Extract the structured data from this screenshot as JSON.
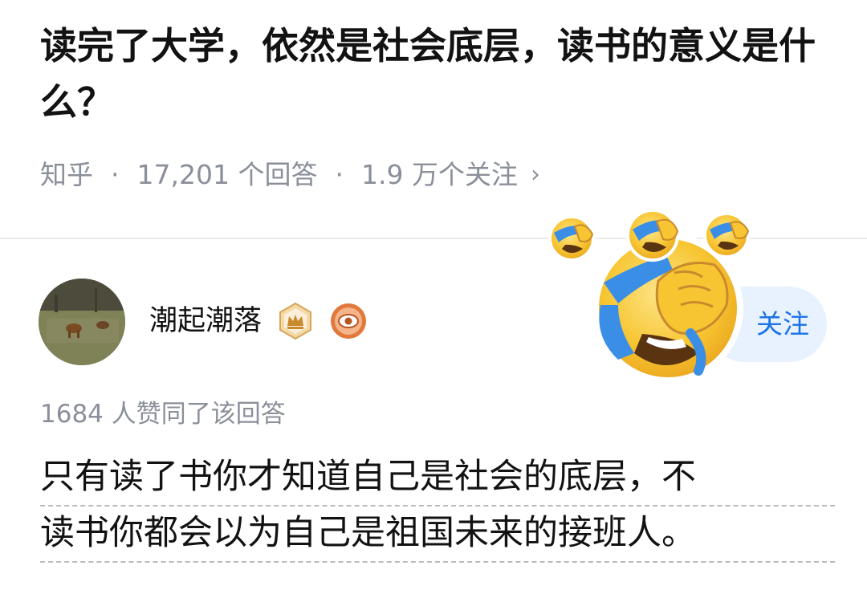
{
  "question": {
    "title": "读完了大学，依然是社会底层，读书的意义是什么？",
    "source": "知乎",
    "separator": "·",
    "answers_count": "17,201 个回答",
    "followers": "1.9 万个关注",
    "chevron": "›"
  },
  "answer": {
    "author": {
      "name": "潮起潮落",
      "badges": [
        "crown-badge-icon",
        "eye-badge-icon"
      ]
    },
    "follow_label": "关注",
    "likes": "1684 人赞同了该回答",
    "content_lines": [
      "只有读了书你才知道自己是社会的底层，不",
      "读书你都会以为自己是祖国未来的接班人。"
    ]
  },
  "colors": {
    "text": "#121212",
    "muted": "#8a8f99",
    "follow_bg": "#e8f2ff",
    "follow_text": "#1a73e8",
    "emoji_yellow": "#f7c531",
    "tear_blue": "#3a8ee6"
  }
}
